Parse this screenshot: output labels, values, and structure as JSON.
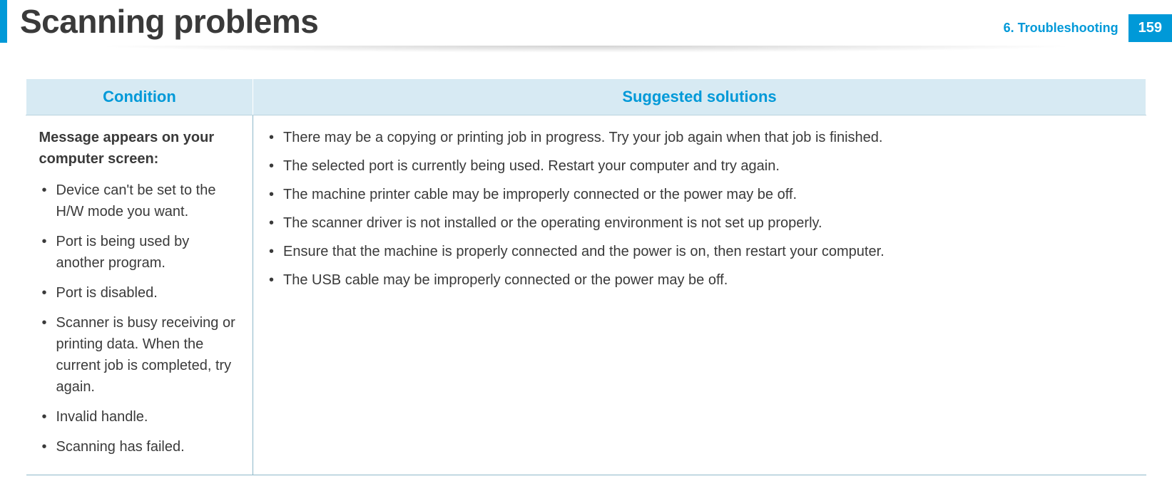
{
  "header": {
    "title": "Scanning problems",
    "chapter": "6.  Troubleshooting",
    "page_number": "159"
  },
  "table": {
    "headers": {
      "condition": "Condition",
      "solutions": "Suggested solutions"
    },
    "row": {
      "condition_title": "Message appears on your computer screen:",
      "condition_items": [
        "Device can't be set to the H/W mode you want.",
        "Port is being used by another program.",
        "Port is disabled.",
        "Scanner is busy receiving or printing data. When the current job is completed, try again.",
        "Invalid handle.",
        "Scanning has failed."
      ],
      "solution_items": [
        "There may be a copying or printing job in progress. Try your job again when that job is finished.",
        "The selected port is currently being used. Restart your computer and try again.",
        "The machine printer cable may be improperly connected or the power may be off.",
        "The scanner driver is not installed or the operating environment is not set up properly.",
        "Ensure that the machine is properly connected and the power is on, then restart your computer.",
        "The USB cable may be improperly connected or the power may be off."
      ]
    }
  }
}
